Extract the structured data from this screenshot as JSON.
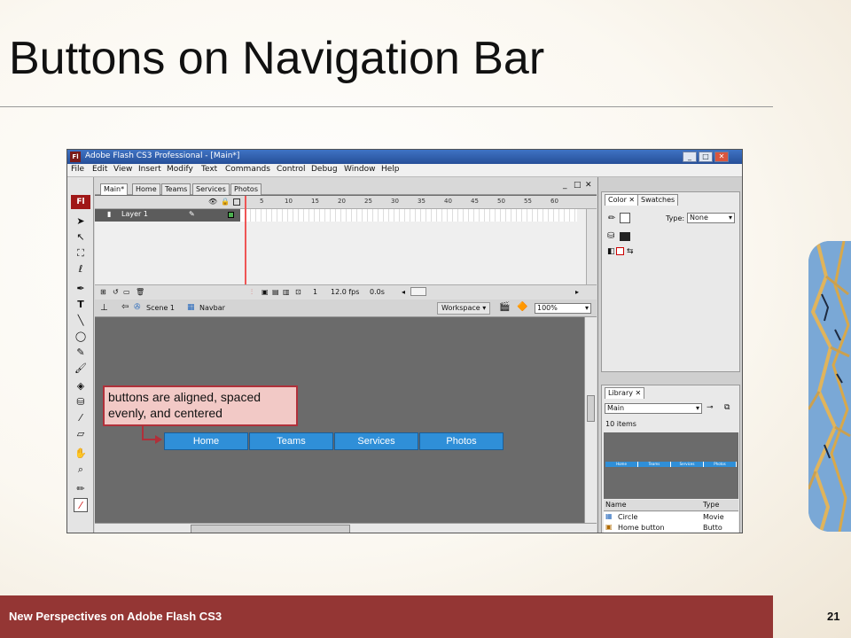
{
  "slide": {
    "title": "Buttons on Navigation Bar",
    "footer": "New Perspectives on Adobe Flash CS3",
    "page_number": "21"
  },
  "app": {
    "icon_text": "Fl",
    "title": "Adobe Flash CS3 Professional - [Main*]",
    "window_buttons": [
      "_",
      "□",
      "✕"
    ],
    "menu": [
      "File",
      "Edit",
      "View",
      "Insert",
      "Modify",
      "Text",
      "Commands",
      "Control",
      "Debug",
      "Window",
      "Help"
    ],
    "tools": {
      "logo": "Fl"
    },
    "document": {
      "tabs": [
        "Main*",
        "Home",
        "Teams",
        "Services",
        "Photos"
      ],
      "active_tab": "Main*",
      "tab_controls": [
        "_",
        "□",
        "✕"
      ]
    },
    "timeline": {
      "layer_name": "Layer 1",
      "frame_numbers": [
        "5",
        "10",
        "15",
        "20",
        "25",
        "30",
        "35",
        "40",
        "45",
        "50",
        "55",
        "60"
      ],
      "current_frame": "1",
      "frame_rate": "12.0 fps",
      "elapsed": "0.0s"
    },
    "edit_bar": {
      "scene": "Scene 1",
      "symbol": "Navbar",
      "workspace": "Workspace ▾",
      "zoom": "100%"
    },
    "stage": {
      "callout": "buttons are aligned, spaced evenly, and centered",
      "nav_buttons": [
        "Home",
        "Teams",
        "Services",
        "Photos"
      ]
    },
    "color_panel": {
      "tabs": [
        "Color ✕",
        "Swatches"
      ],
      "type_label": "Type:",
      "type_value": "None"
    },
    "library_panel": {
      "tab": "Library ✕",
      "source": "Main",
      "item_count": "10 items",
      "preview_buttons": [
        "Home",
        "Teams",
        "Services",
        "Photos"
      ],
      "columns": [
        "Name",
        "Type"
      ],
      "rows": [
        {
          "name": "Circle",
          "type": "Movie"
        },
        {
          "name": "Home button",
          "type": "Butto"
        }
      ]
    }
  }
}
